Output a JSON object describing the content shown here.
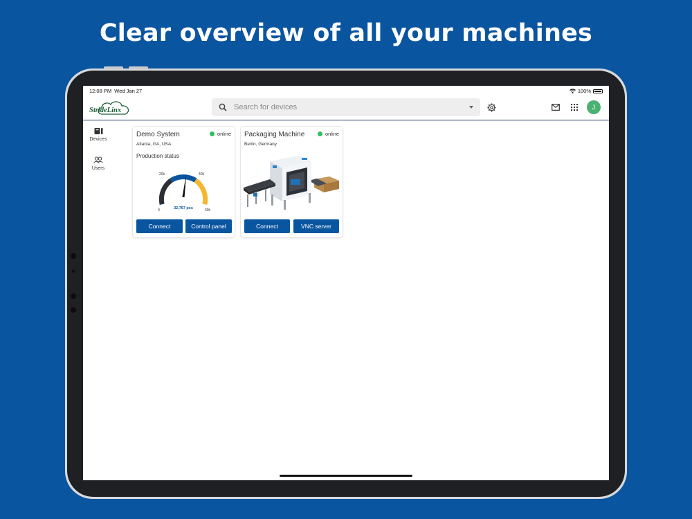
{
  "headline": "Clear overview of all your machines",
  "statusbar": {
    "time": "12:08 PM",
    "date": "Wed Jan 27",
    "battery": "100%"
  },
  "appbar": {
    "logo_text": "StrideLinx",
    "search_placeholder": "Search for devices",
    "avatar_initial": "J"
  },
  "sidenav": {
    "items": [
      {
        "label": "Devices",
        "icon": "devices-icon"
      },
      {
        "label": "Users",
        "icon": "users-icon"
      }
    ]
  },
  "devices": [
    {
      "name": "Demo System",
      "status": "online",
      "location": "Atlanta, GA, USA",
      "widget_title": "Production status",
      "gauge": {
        "value_label": "32,767 pcs",
        "ticks": [
          "0",
          "20k",
          "40k",
          "60k"
        ]
      },
      "buttons": [
        "Connect",
        "Control panel"
      ]
    },
    {
      "name": "Packaging Machine",
      "status": "online",
      "location": "Berlin, Germany",
      "buttons": [
        "Connect",
        "VNC server"
      ]
    }
  ],
  "colors": {
    "background": "#0a55a0",
    "online": "#2fbf5e",
    "button": "#0a55a0",
    "gauge_dark": "#2b2f36",
    "gauge_blue": "#0a55a0",
    "gauge_yellow": "#f4b731",
    "avatar": "#4bb173"
  }
}
